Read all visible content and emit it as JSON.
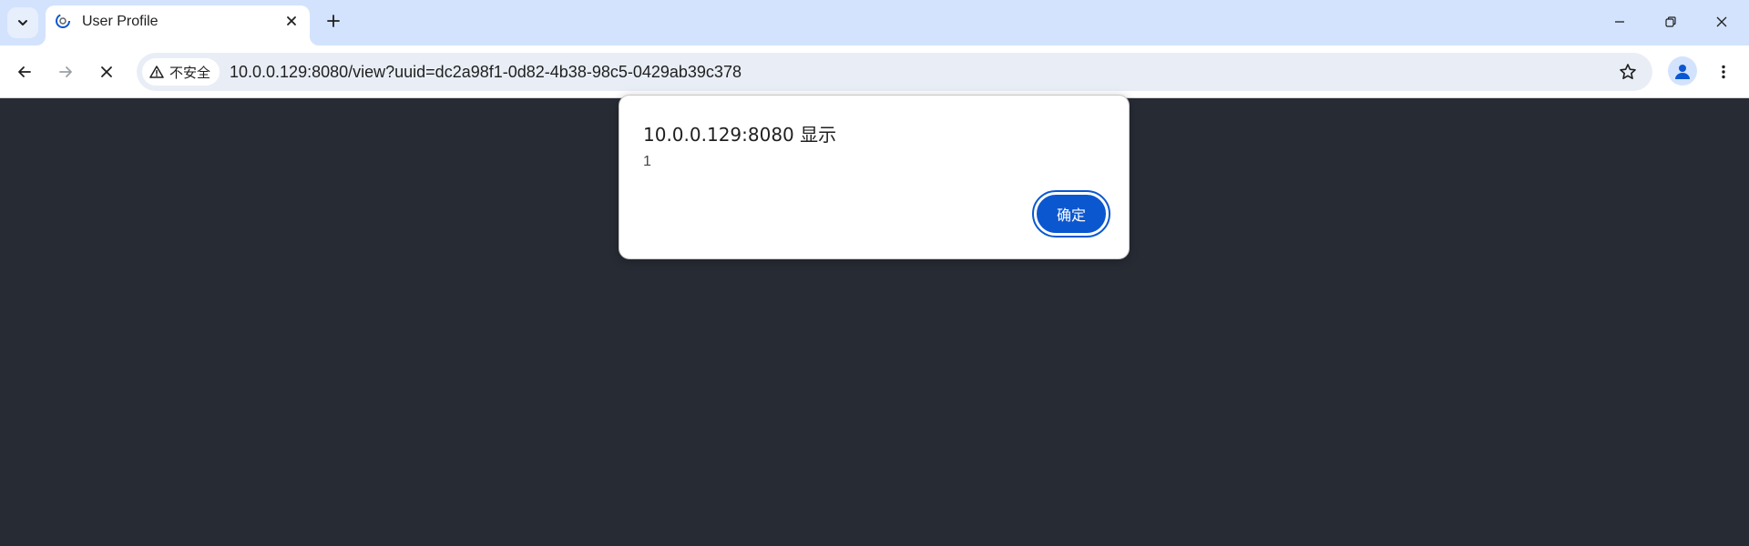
{
  "tabstrip": {
    "tab_search_icon": "chevron-down-icon",
    "active_tab": {
      "title": "User Profile",
      "favicon": "loading-globe-icon",
      "close_icon": "close-icon"
    },
    "new_tab_icon": "plus-icon",
    "window_controls": [
      "minimize-icon",
      "restore-icon",
      "close-icon"
    ]
  },
  "toolbar": {
    "back_icon": "arrow-left-icon",
    "forward_icon": "arrow-right-icon",
    "stop_icon": "close-icon",
    "security_label": "不安全",
    "security_icon": "warning-triangle-icon",
    "url": "10.0.0.129:8080/view?uuid=dc2a98f1-0d82-4b38-98c5-0429ab39c378",
    "bookmark_icon": "star-icon",
    "profile_icon": "person-icon",
    "menu_icon": "vertical-dots-icon"
  },
  "dialog": {
    "title": "10.0.0.129:8080 显示",
    "message": "1",
    "ok_label": "确定"
  },
  "colors": {
    "tabstrip_bg": "#d3e3fd",
    "page_bg": "#272b34",
    "omnibox_bg": "#e9eef6",
    "accent": "#0b57d0"
  }
}
